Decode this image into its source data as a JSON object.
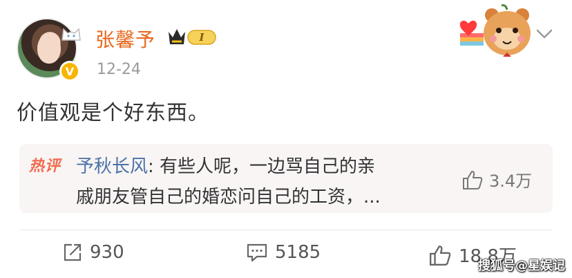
{
  "post": {
    "username": "张馨予",
    "vip_level": "I",
    "timestamp": "12-24",
    "content": "价值观是个好东西。"
  },
  "hot_comment": {
    "tag": "热评",
    "commenter": "予秋长风",
    "text_line1": ": 有些人呢，一边骂自己的亲",
    "text_line2": "戚朋友管自己的婚恋问自己的工资，...",
    "like_count": "3.4万"
  },
  "actions": {
    "repost_count": "930",
    "comment_count": "5185",
    "like_count": "18.8万"
  },
  "watermark": "搜狐号@星娱记",
  "icons": [
    "avatar",
    "verified-badge-icon",
    "cat-decoration-icon",
    "crown-vip-badge-icon",
    "bear-heart-decoration-icon",
    "chevron-down-icon",
    "thumbs-up-icon",
    "repost-icon",
    "comment-icon"
  ],
  "colors": {
    "username": "#e8671b",
    "commenter": "#4a73a6",
    "hot_tag": "#f26b4f",
    "hot_comment_bg": "#f9f5f5",
    "timestamp": "#9a9a9a"
  }
}
